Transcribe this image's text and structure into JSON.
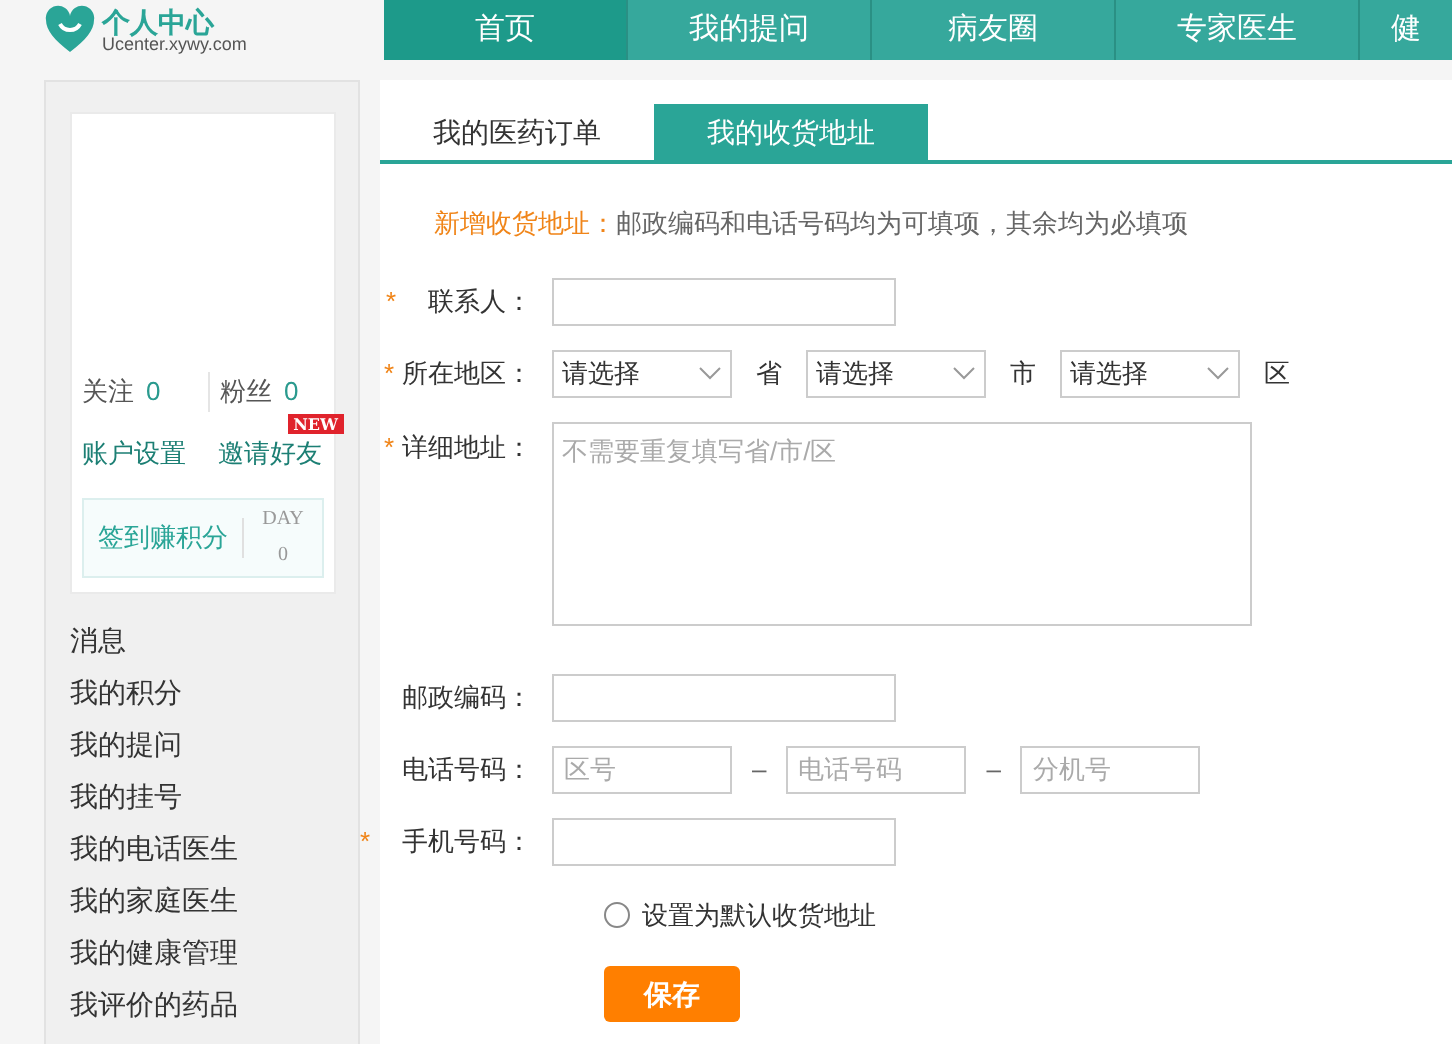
{
  "header": {
    "logo": {
      "title": "个人中心",
      "subtitle": "Ucenter.xywy.com"
    },
    "nav": [
      {
        "label": "首页",
        "selected": true
      },
      {
        "label": "我的提问",
        "selected": false
      },
      {
        "label": "病友圈",
        "selected": false
      },
      {
        "label": "专家医生",
        "selected": false
      },
      {
        "label": "健",
        "selected": false
      }
    ]
  },
  "profile": {
    "stats": [
      {
        "label": "关注",
        "count": "0"
      },
      {
        "label": "粉丝",
        "count": "0"
      }
    ],
    "badge": "NEW",
    "links": [
      "账户设置",
      "邀请好友"
    ],
    "checkin": {
      "label": "签到赚积分",
      "day_label": "DAY",
      "day_count": "0"
    }
  },
  "sidebar": {
    "items": [
      "消息",
      "我的积分",
      "我的提问",
      "我的挂号",
      "我的电话医生",
      "我的家庭医生",
      "我的健康管理",
      "我评价的药品"
    ]
  },
  "tabs": [
    {
      "label": "我的医药订单",
      "selected": false
    },
    {
      "label": "我的收货地址",
      "selected": true
    }
  ],
  "form": {
    "notice": {
      "title": "新增收货地址：",
      "text": "邮政编码和电话号码均为可填项，其余均为必填项"
    },
    "fields": [
      {
        "kind": "text",
        "marker": "*",
        "label": "联系人："
      },
      {
        "kind": "selects",
        "marker": "*",
        "label": "所在地区：",
        "selects": [
          {
            "value": "请选择",
            "unit": "省"
          },
          {
            "value": "请选择",
            "unit": "市"
          },
          {
            "value": "请选择",
            "unit": "区"
          }
        ]
      },
      {
        "kind": "textarea",
        "marker": "*",
        "label": "详细地址：",
        "placeholder": "不需要重复填写省/市/区"
      },
      {
        "kind": "text",
        "label": "邮政编码："
      },
      {
        "kind": "phone",
        "label": "电话号码：",
        "parts": [
          {
            "placeholder": "区号"
          },
          {
            "separator": "–",
            "placeholder": "电话号码"
          },
          {
            "separator": "–",
            "placeholder": "分机号"
          }
        ]
      },
      {
        "kind": "text",
        "marker": "*",
        "label": "手机号码："
      }
    ],
    "default_option": {
      "label": "设置为默认收货地址",
      "selected": false
    },
    "save_button": "保存"
  }
}
